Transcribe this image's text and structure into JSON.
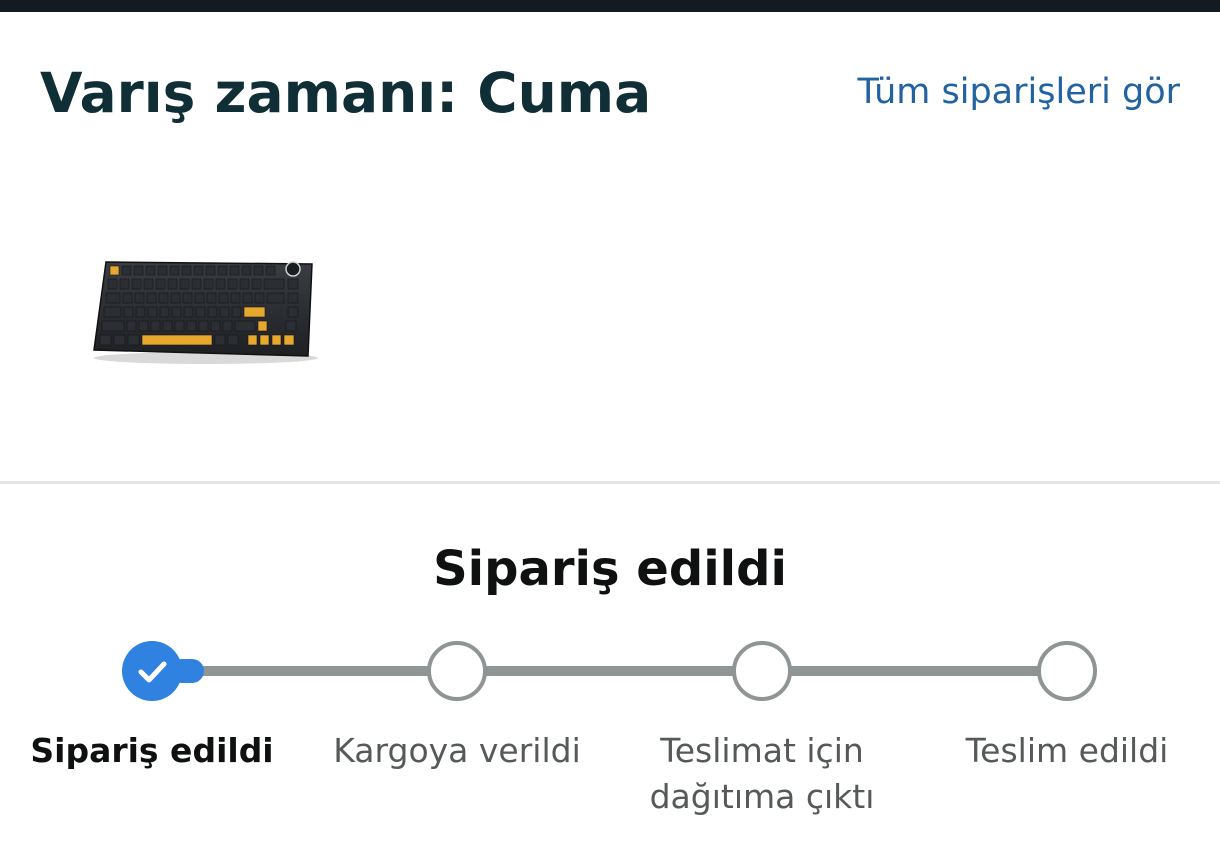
{
  "header": {
    "eta_title": "Varış zamanı: Cuma",
    "all_orders_link": "Tüm siparişleri gör"
  },
  "product": {
    "image_icon": "mechanical-keyboard-image"
  },
  "status": {
    "heading": "Sipariş edildi",
    "steps": [
      {
        "label": "Sipariş edildi",
        "state": "done"
      },
      {
        "label": "Kargoya verildi",
        "state": "pending"
      },
      {
        "label": "Teslimat için\ndağıtıma çıktı",
        "state": "pending"
      },
      {
        "label": "Teslim edildi",
        "state": "pending"
      }
    ],
    "progress_fraction": 0.0
  },
  "colors": {
    "title": "#0f2e36",
    "link": "#2162a1",
    "active_step": "#2f82e0",
    "inactive_step": "#8f9494"
  }
}
